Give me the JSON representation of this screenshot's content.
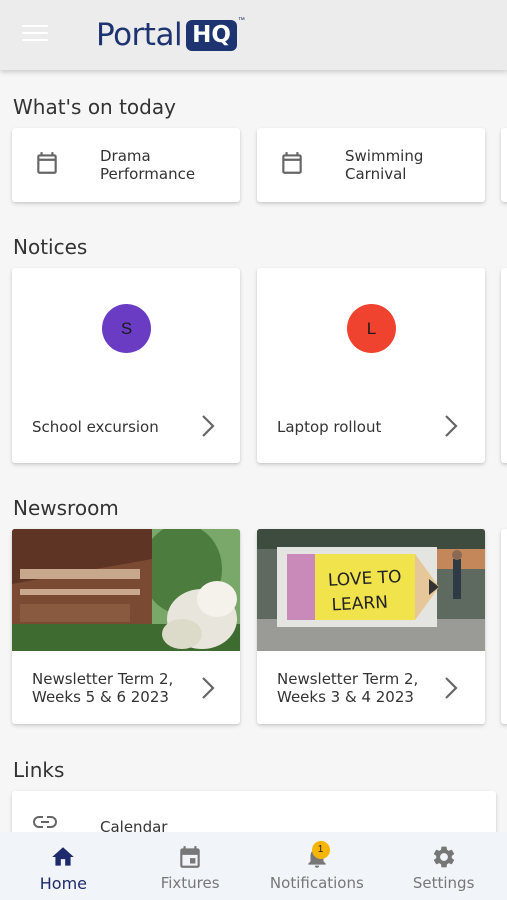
{
  "app": {
    "logo_text": "Portal",
    "logo_badge": "HQ",
    "logo_tm": "™"
  },
  "sections": {
    "today": "What's on today",
    "notices": "Notices",
    "newsroom": "Newsroom",
    "links": "Links"
  },
  "today": [
    {
      "label": "Drama Performance"
    },
    {
      "label": "Swimming Carnival"
    }
  ],
  "notices": [
    {
      "initial": "S",
      "label": "School excursion",
      "color": "#6a3cc4"
    },
    {
      "initial": "L",
      "label": "Laptop rollout",
      "color": "#f0432f"
    }
  ],
  "news": [
    {
      "label": "Newsletter Term 2, Weeks 5 & 6 2023"
    },
    {
      "label": "Newsletter Term 2, Weeks 3 & 4 2023",
      "image_text": "LOVE TO LEARN"
    }
  ],
  "links": [
    {
      "label": "Calendar"
    }
  ],
  "nav": [
    {
      "label": "Home",
      "icon": "home-icon",
      "active": true
    },
    {
      "label": "Fixtures",
      "icon": "calendar-icon"
    },
    {
      "label": "Notifications",
      "icon": "bell-icon",
      "badge": "1"
    },
    {
      "label": "Settings",
      "icon": "gear-icon"
    }
  ],
  "colors": {
    "brand": "#1d3471",
    "active_nav": "#1d2a6b",
    "badge": "#f7b500"
  }
}
